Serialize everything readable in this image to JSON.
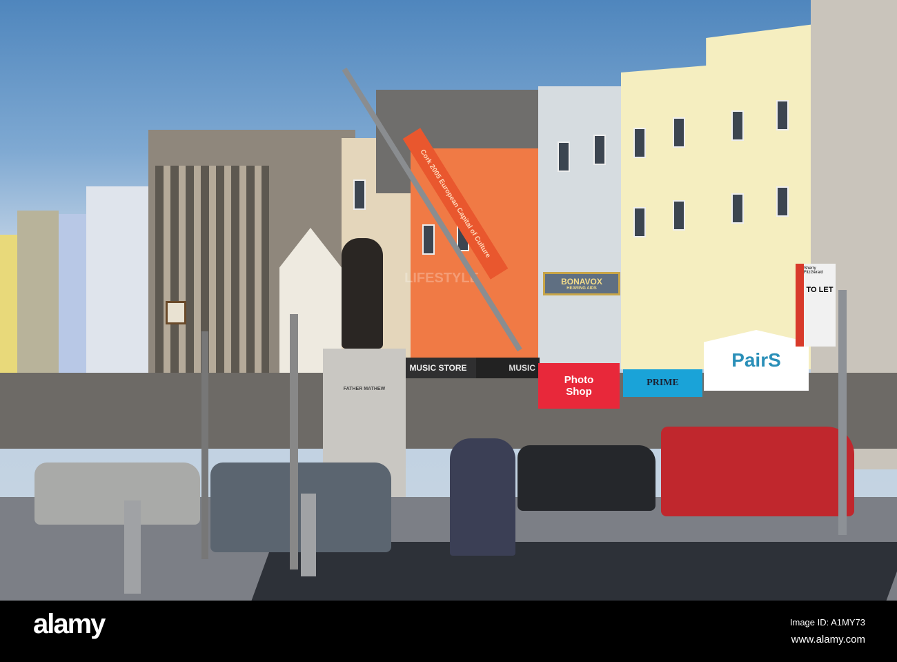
{
  "scene": {
    "signs": {
      "music_store": "MUSIC STORE",
      "music": "MUSIC",
      "photo_shop_line1": "Photo",
      "photo_shop_line2": "Shop",
      "prime": "PRIME",
      "pairs": "PairS",
      "bonavox": "BONAVOX",
      "bonavox_sub": "HEARING AIDS",
      "to_let": "TO LET",
      "estate_agent": "Sherry FitzGerald",
      "banner": "Cork 2005 European Capital of Culture",
      "statue_plinth": "FATHER MATHEW",
      "lifestyle": "LIFESTYLE"
    },
    "colors": {
      "sky": "#6f9ccb",
      "orange_building": "#f07a45",
      "yellow_building": "#f5eec0",
      "photo_shop": "#e8283a",
      "prime": "#1aa3d8",
      "van": "#c0272d"
    }
  },
  "footer": {
    "logo": "alamy",
    "image_id": "Image ID: A1MY73",
    "url": "www.alamy.com"
  }
}
